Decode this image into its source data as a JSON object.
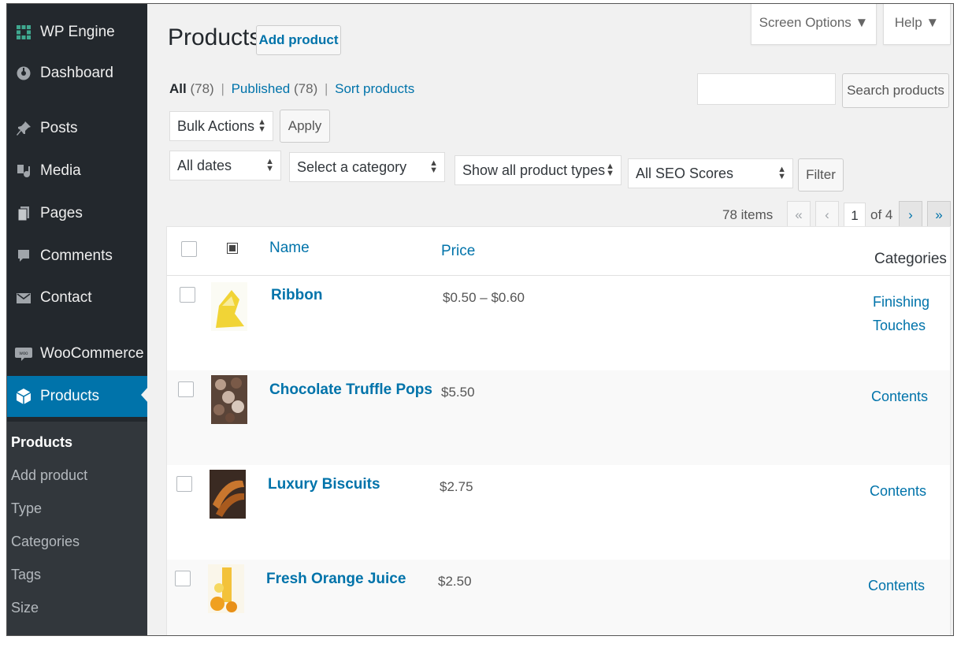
{
  "sidebar": {
    "top_items": [
      {
        "label": "WP Engine",
        "icon": "wp-engine-icon"
      },
      {
        "label": "Dashboard",
        "icon": "dashboard-icon"
      },
      {
        "label": "Posts",
        "icon": "pin-icon"
      },
      {
        "label": "Media",
        "icon": "media-icon"
      },
      {
        "label": "Pages",
        "icon": "pages-icon"
      },
      {
        "label": "Comments",
        "icon": "comment-icon"
      },
      {
        "label": "Contact",
        "icon": "mail-icon"
      },
      {
        "label": "WooCommerce",
        "icon": "woocommerce-icon"
      },
      {
        "label": "Products",
        "icon": "products-box-icon",
        "active": true
      }
    ],
    "submenu": [
      {
        "label": "Products",
        "current": true
      },
      {
        "label": "Add product"
      },
      {
        "label": "Type"
      },
      {
        "label": "Categories"
      },
      {
        "label": "Tags"
      },
      {
        "label": "Size"
      }
    ]
  },
  "header": {
    "title": "Products",
    "add_button": "Add product",
    "screen_options": "Screen Options ▼",
    "help": "Help ▼"
  },
  "views": {
    "all_label": "All",
    "all_count": "(78)",
    "published_label": "Published",
    "published_count": "(78)",
    "sort_label": "Sort products",
    "separator": "|"
  },
  "search": {
    "value": "",
    "button": "Search products"
  },
  "bulk": {
    "selected": "Bulk Actions",
    "apply": "Apply"
  },
  "filters": {
    "dates": "All dates",
    "category": "Select a category",
    "product_type": "Show all product types",
    "seo": "All SEO Scores",
    "filter_button": "Filter"
  },
  "pagination": {
    "items": "78 items",
    "first": "«",
    "prev": "‹",
    "current_page": "1",
    "of_total": "of 4",
    "next": "›",
    "last": "»"
  },
  "table": {
    "columns": {
      "name": "Name",
      "price": "Price",
      "categories": "Categories"
    },
    "rows": [
      {
        "name": "Ribbon",
        "price": "$0.50 – $0.60",
        "category": "Finishing Touches"
      },
      {
        "name": "Chocolate Truffle Pops",
        "price": "$5.50",
        "category": "Contents"
      },
      {
        "name": "Luxury Biscuits",
        "price": "$2.75",
        "category": "Contents"
      },
      {
        "name": "Fresh Orange Juice",
        "price": "$2.50",
        "category": "Contents"
      }
    ]
  },
  "colors": {
    "sidebar_bg": "#23282d",
    "accent": "#0073aa",
    "page_bg": "#f1f1f1"
  }
}
